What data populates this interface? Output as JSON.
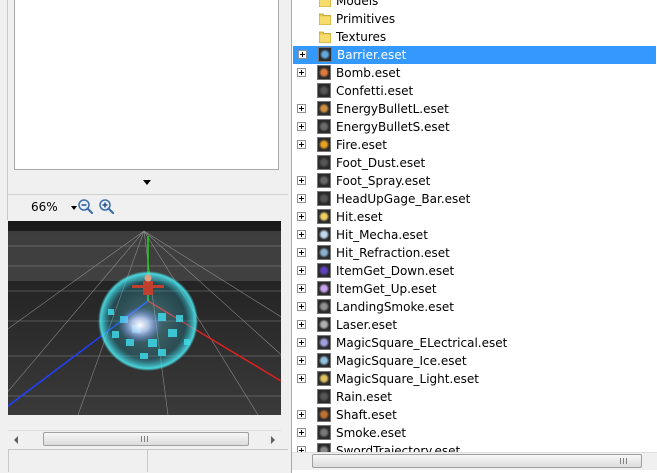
{
  "viewer": {
    "zoom_value": "66%",
    "zoom_out_icon": "zoom-out-icon",
    "zoom_in_icon": "zoom-in-icon"
  },
  "scroll": {
    "grip": "III"
  },
  "tree": {
    "folders": [
      "Models",
      "Primitives",
      "Textures"
    ],
    "files": [
      {
        "label": "Barrier.eset",
        "expandable": true,
        "selected": true,
        "icon_color": "#5fa8d8"
      },
      {
        "label": "Bomb.eset",
        "expandable": true,
        "selected": false,
        "icon_color": "#e07a3a"
      },
      {
        "label": "Confetti.eset",
        "expandable": false,
        "selected": false,
        "icon_color": "#555555"
      },
      {
        "label": "EnergyBulletL.eset",
        "expandable": true,
        "selected": false,
        "icon_color": "#d09040"
      },
      {
        "label": "EnergyBulletS.eset",
        "expandable": true,
        "selected": false,
        "icon_color": "#6a6a6a"
      },
      {
        "label": "Fire.eset",
        "expandable": true,
        "selected": false,
        "icon_color": "#e8a020"
      },
      {
        "label": "Foot_Dust.eset",
        "expandable": false,
        "selected": false,
        "icon_color": "#555555"
      },
      {
        "label": "Foot_Spray.eset",
        "expandable": true,
        "selected": false,
        "icon_color": "#666666"
      },
      {
        "label": "HeadUpGage_Bar.eset",
        "expandable": true,
        "selected": false,
        "icon_color": "#555555"
      },
      {
        "label": "Hit.eset",
        "expandable": true,
        "selected": false,
        "icon_color": "#f0d060"
      },
      {
        "label": "Hit_Mecha.eset",
        "expandable": true,
        "selected": false,
        "icon_color": "#c0d8f0"
      },
      {
        "label": "Hit_Refraction.eset",
        "expandable": true,
        "selected": false,
        "icon_color": "#8ab0d0"
      },
      {
        "label": "ItemGet_Down.eset",
        "expandable": true,
        "selected": false,
        "icon_color": "#6040c0"
      },
      {
        "label": "ItemGet_Up.eset",
        "expandable": true,
        "selected": false,
        "icon_color": "#c8a0f0"
      },
      {
        "label": "LandingSmoke.eset",
        "expandable": true,
        "selected": false,
        "icon_color": "#909090"
      },
      {
        "label": "Laser.eset",
        "expandable": true,
        "selected": false,
        "icon_color": "#b0b0b0"
      },
      {
        "label": "MagicSquare_ELectrical.eset",
        "expandable": true,
        "selected": false,
        "icon_color": "#a0a0e0"
      },
      {
        "label": "MagicSquare_Ice.eset",
        "expandable": true,
        "selected": false,
        "icon_color": "#90c0e0"
      },
      {
        "label": "MagicSquare_Light.eset",
        "expandable": true,
        "selected": false,
        "icon_color": "#e0c060"
      },
      {
        "label": "Rain.eset",
        "expandable": false,
        "selected": false,
        "icon_color": "#555555"
      },
      {
        "label": "Shaft.eset",
        "expandable": true,
        "selected": false,
        "icon_color": "#c07030"
      },
      {
        "label": "Smoke.eset",
        "expandable": true,
        "selected": false,
        "icon_color": "#777777"
      },
      {
        "label": "SwordTrajectory.eset",
        "expandable": true,
        "selected": false,
        "icon_color": "#888888"
      }
    ]
  },
  "colors": {
    "selection": "#3399ff",
    "viewport_bg": "#2a2a2a",
    "barrier_glow": "#34e0e8"
  }
}
